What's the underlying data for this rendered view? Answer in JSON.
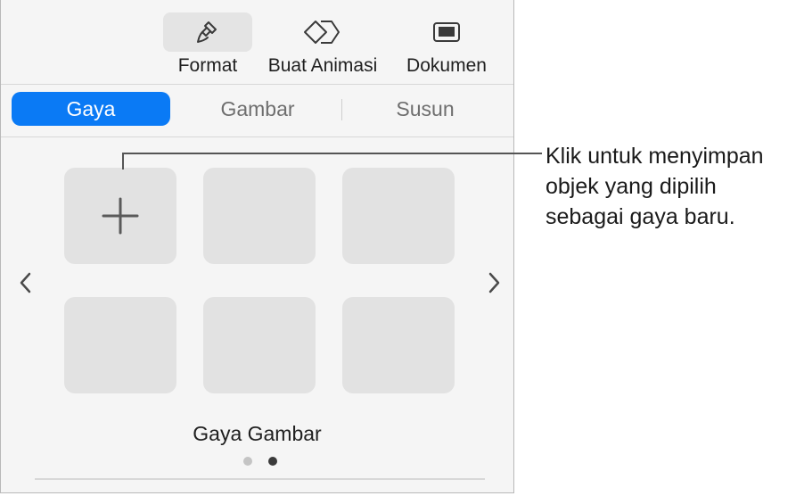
{
  "toolbar": {
    "format_label": "Format",
    "animate_label": "Buat Animasi",
    "document_label": "Dokumen"
  },
  "tabs": [
    {
      "label": "Gaya",
      "active": true
    },
    {
      "label": "Gambar",
      "active": false
    },
    {
      "label": "Susun",
      "active": false
    }
  ],
  "gallery": {
    "title": "Gaya Gambar",
    "page_count": 2,
    "current_page": 2
  },
  "callout": {
    "lines": [
      "Klik untuk menyimpan",
      "objek yang dipilih",
      "sebagai gaya baru."
    ]
  },
  "colors": {
    "accent": "#0a7af5",
    "tile": "#e2e2e2",
    "panel": "#f5f5f5"
  },
  "icons": [
    "paintbrush-icon",
    "animate-diamond-icon",
    "document-icon",
    "plus-icon",
    "chevron-left-icon",
    "chevron-right-icon"
  ]
}
